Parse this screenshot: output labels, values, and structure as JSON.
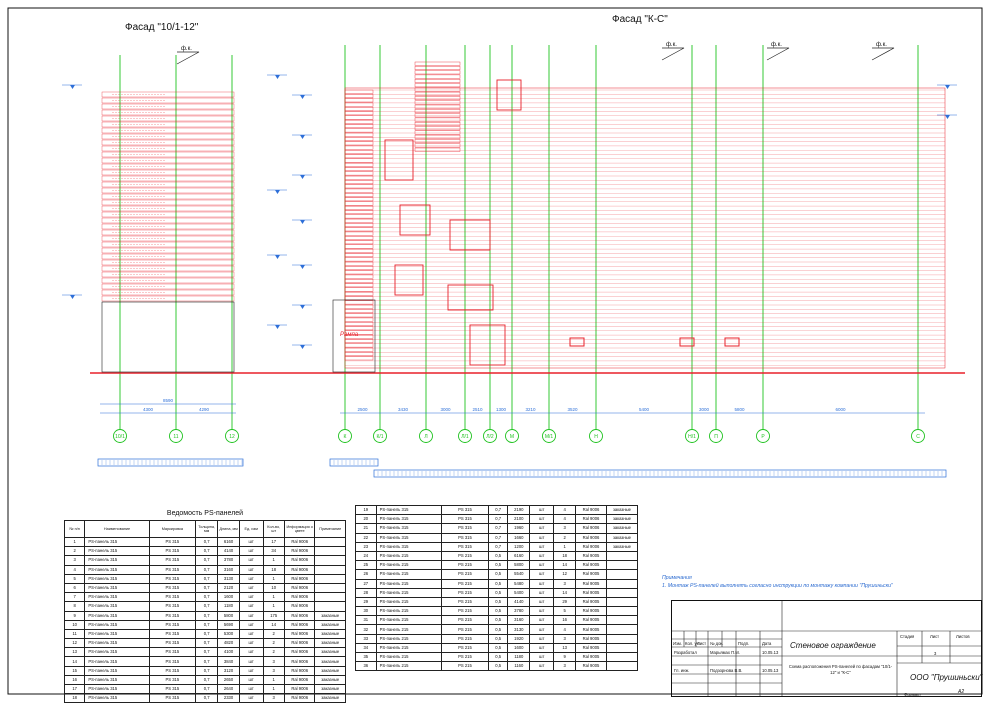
{
  "facades": {
    "left_title": "Фасад \"10/1-12\"",
    "right_title": "Фасад \"К-С\"",
    "marker": "ф.к.",
    "ramp_label": "Рампа"
  },
  "axes_left": [
    "10/1",
    "11",
    "12"
  ],
  "axes_right": [
    "К",
    "К/1",
    "Л",
    "Л/1",
    "Л/2",
    "М",
    "М/1",
    "Н",
    "Н/1",
    "П",
    "Р",
    "С"
  ],
  "dims_left": [
    "4300",
    "4290"
  ],
  "dims_left_total": "8590",
  "dims_right": [
    "2500",
    "3430",
    "3000",
    "2510",
    "1300",
    "3210",
    "3520",
    "5400",
    "3000",
    "5800",
    "6000"
  ],
  "schedule": {
    "title": "Ведомость PS-панелей",
    "headers": [
      "№ п/п",
      "Наименование",
      "Маркировка",
      "Толщина, мм",
      "Длина, мм",
      "Ед. изм",
      "Кол-во, шт",
      "Информация о цвете",
      "Примечание"
    ],
    "rows_left": [
      [
        "1",
        "PS-панель 315",
        "PS 315",
        "0,7",
        "6160",
        "шт",
        "17",
        "Ral 9006",
        ""
      ],
      [
        "2",
        "PS-панель 315",
        "PS 315",
        "0,7",
        "4140",
        "шт",
        "34",
        "Ral 9006",
        ""
      ],
      [
        "3",
        "PS-панель 315",
        "PS 315",
        "0,7",
        "3780",
        "шт",
        "1",
        "Ral 9006",
        ""
      ],
      [
        "4",
        "PS-панель 315",
        "PS 315",
        "0,7",
        "3160",
        "шт",
        "18",
        "Ral 9006",
        ""
      ],
      [
        "5",
        "PS-панель 315",
        "PS 315",
        "0,7",
        "3130",
        "шт",
        "1",
        "Ral 9006",
        ""
      ],
      [
        "6",
        "PS-панель 315",
        "PS 315",
        "0,7",
        "2120",
        "шт",
        "10",
        "Ral 9006",
        ""
      ],
      [
        "7",
        "PS-панель 315",
        "PS 315",
        "0,7",
        "1600",
        "шт",
        "1",
        "Ral 9006",
        ""
      ],
      [
        "8",
        "PS-панель 315",
        "PS 315",
        "0,7",
        "1180",
        "шт",
        "1",
        "Ral 9006",
        ""
      ],
      [
        "9",
        "PS-панель 315",
        "PS 315",
        "0,7",
        "5800",
        "шт",
        "175",
        "Ral 9006",
        "заказные"
      ],
      [
        "10",
        "PS-панель 315",
        "PS 315",
        "0,7",
        "5690",
        "шт",
        "14",
        "Ral 9006",
        "заказные"
      ],
      [
        "11",
        "PS-панель 315",
        "PS 315",
        "0,7",
        "5300",
        "шт",
        "2",
        "Ral 9006",
        "заказные"
      ],
      [
        "12",
        "PS-панель 315",
        "PS 315",
        "0,7",
        "4820",
        "шт",
        "2",
        "Ral 9006",
        "заказные"
      ],
      [
        "13",
        "PS-панель 315",
        "PS 315",
        "0,7",
        "4100",
        "шт",
        "2",
        "Ral 9006",
        "заказные"
      ],
      [
        "14",
        "PS-панель 315",
        "PS 315",
        "0,7",
        "3840",
        "шт",
        "3",
        "Ral 9006",
        "заказные"
      ],
      [
        "15",
        "PS-панель 315",
        "PS 315",
        "0,7",
        "3120",
        "шт",
        "3",
        "Ral 9006",
        "заказные"
      ],
      [
        "16",
        "PS-панель 315",
        "PS 315",
        "0,7",
        "2650",
        "шт",
        "1",
        "Ral 9006",
        "заказные"
      ],
      [
        "17",
        "PS-панель 315",
        "PS 315",
        "0,7",
        "2640",
        "шт",
        "1",
        "Ral 9006",
        "заказные"
      ],
      [
        "18",
        "PS-панель 315",
        "PS 315",
        "0,7",
        "2330",
        "шт",
        "3",
        "Ral 9006",
        "заказные"
      ]
    ],
    "rows_right": [
      [
        "19",
        "PS-панель 315",
        "PS 315",
        "0,7",
        "2190",
        "шт",
        "4",
        "Ral 9006",
        "заказные"
      ],
      [
        "20",
        "PS-панель 315",
        "PS 315",
        "0,7",
        "2100",
        "шт",
        "4",
        "Ral 9006",
        "заказные"
      ],
      [
        "21",
        "PS-панель 315",
        "PS 315",
        "0,7",
        "1960",
        "шт",
        "3",
        "Ral 9006",
        "заказные"
      ],
      [
        "22",
        "PS-панель 315",
        "PS 315",
        "0,7",
        "1660",
        "шт",
        "2",
        "Ral 9006",
        "заказные"
      ],
      [
        "23",
        "PS-панель 315",
        "PS 315",
        "0,7",
        "1200",
        "шт",
        "1",
        "Ral 9006",
        "заказные"
      ],
      [
        "24",
        "PS-панель 215",
        "PS 215",
        "0,5",
        "6160",
        "шт",
        "18",
        "Ral 9005",
        ""
      ],
      [
        "25",
        "PS-панель 215",
        "PS 215",
        "0,5",
        "5800",
        "шт",
        "14",
        "Ral 9005",
        ""
      ],
      [
        "26",
        "PS-панель 215",
        "PS 215",
        "0,5",
        "5540",
        "шт",
        "12",
        "Ral 9005",
        ""
      ],
      [
        "27",
        "PS-панель 215",
        "PS 215",
        "0,5",
        "5480",
        "шт",
        "3",
        "Ral 9005",
        ""
      ],
      [
        "28",
        "PS-панель 215",
        "PS 215",
        "0,5",
        "5400",
        "шт",
        "14",
        "Ral 9005",
        ""
      ],
      [
        "29",
        "PS-панель 215",
        "PS 215",
        "0,5",
        "4140",
        "шт",
        "29",
        "Ral 9005",
        ""
      ],
      [
        "30",
        "PS-панель 215",
        "PS 215",
        "0,5",
        "3780",
        "шт",
        "5",
        "Ral 9005",
        ""
      ],
      [
        "31",
        "PS-панель 215",
        "PS 215",
        "0,5",
        "3160",
        "шт",
        "16",
        "Ral 9005",
        ""
      ],
      [
        "32",
        "PS-панель 215",
        "PS 215",
        "0,5",
        "3130",
        "шт",
        "4",
        "Ral 9005",
        ""
      ],
      [
        "33",
        "PS-панель 215",
        "PS 215",
        "0,5",
        "1920",
        "шт",
        "3",
        "Ral 9005",
        ""
      ],
      [
        "34",
        "PS-панель 215",
        "PS 215",
        "0,5",
        "1600",
        "шт",
        "13",
        "Ral 9005",
        ""
      ],
      [
        "35",
        "PS-панель 215",
        "PS 215",
        "0,5",
        "1180",
        "шт",
        "9",
        "Ral 9005",
        ""
      ],
      [
        "36",
        "PS-панель 215",
        "PS 215",
        "0,5",
        "1160",
        "шт",
        "3",
        "Ral 9005",
        ""
      ]
    ]
  },
  "note": {
    "heading": "Примечания",
    "text": "1. Монтаж PS-панелей выполнять согласно инструкции по монтажу компании \"Прушиньски\""
  },
  "stamp": {
    "col_headers": [
      "Изм.",
      "Кол. уч.",
      "Лист",
      "№ док.",
      "Подп.",
      "Дата"
    ],
    "developer_role": "Разработал",
    "developer_name": "Марьямах П.М.",
    "developer_date": "10.05.13",
    "checker_role": "Гл. инж.",
    "checker_name": "Подзорнова В.В.",
    "checker_date": "10.05.13",
    "title": "Стеновое ограждение",
    "stage_label": "Стадия",
    "sheet_label": "Лист",
    "sheets_label": "Листов",
    "sheet_number": "3",
    "description": "Схема расположения PS-панелей по фасадам \"10/1-12\" и \"К-С\"",
    "company": "ООО \"Прушиньски\"",
    "format_label": "Формат",
    "format_value": "А2"
  },
  "colors": {
    "panel": "#e8202a",
    "axis": "#1fc21f",
    "dim": "#2d6fd8",
    "ink": "#111111"
  }
}
